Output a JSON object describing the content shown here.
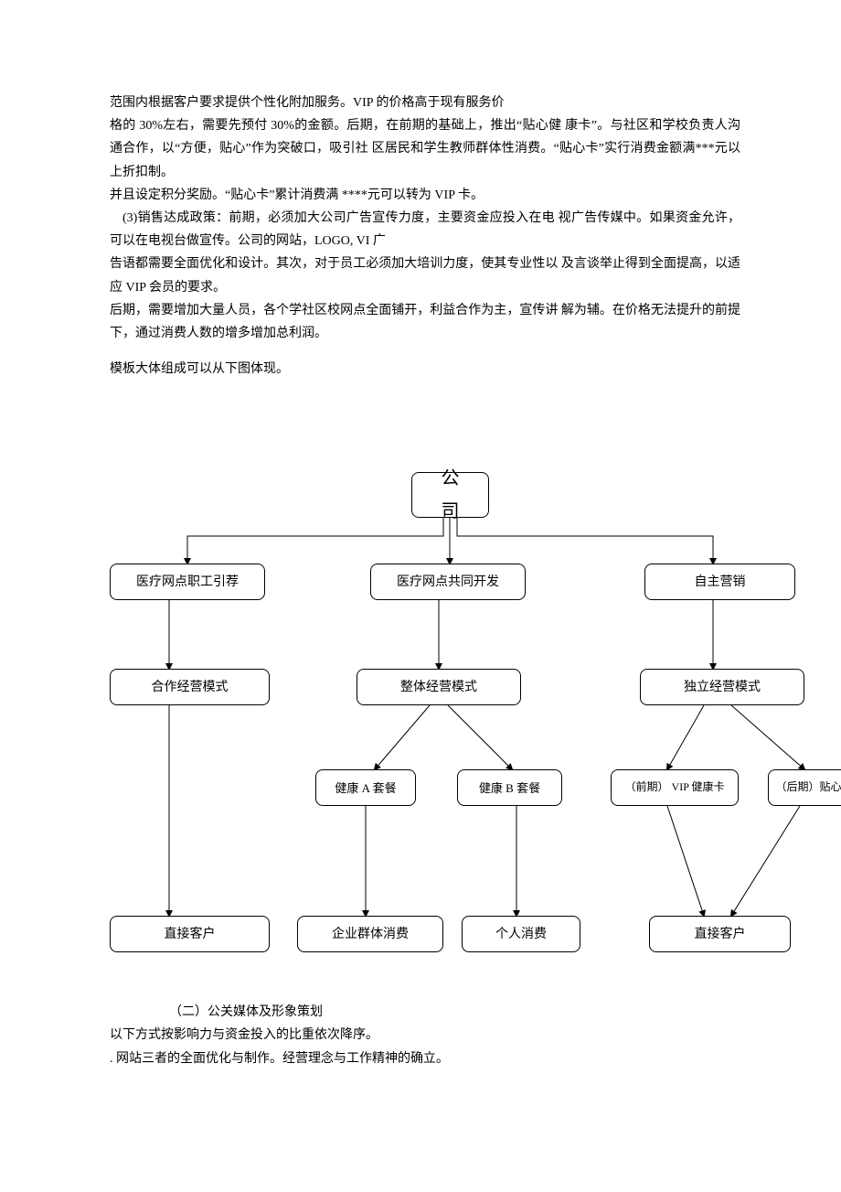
{
  "paragraphs": {
    "p1": "范围内根据客户要求提供个性化附加服务。VIP 的价格高于现有服务价",
    "p2": "格的 30%左右，需要先预付 30%的金额。后期，在前期的基础上，推出“贴心健 康卡”。与社区和学校负责人沟通合作，以“方便，贴心”作为突破口，吸引社 区居民和学生教师群体性消费。“贴心卡”实行消费金额满***元以上折扣制。",
    "p3": "并且设定积分奖励。“贴心卡”累计消费满 ****元可以转为 VIP 卡。",
    "p4": " (3)销售达成政策：前期，必须加大公司广告宣传力度，主要资金应投入在电 视广告传媒中。如果资金允许，可以在电视台做宣传。公司的网站，LOGO, VI 广",
    "p5": "告语都需要全面优化和设计。其次，对于员工必须加大培训力度，使其专业性以 及言谈举止得到全面提高，以适应 VIP 会员的要求。",
    "p6": "后期，需要增加大量人员，各个学社区校网点全面铺开，利益合作为主，宣传讲 解为辅。在价格无法提升的前提下，通过消费人数的增多增加总利润。",
    "p7": "模板大体组成可以从下图体现。"
  },
  "chart_data": {
    "type": "tree",
    "root": "公司",
    "children": [
      {
        "name": "医疗网点职工引荐",
        "model": "合作经营模式",
        "leaves": [
          "直接客户"
        ]
      },
      {
        "name": "医疗网点共同开发",
        "model": "整体经营模式",
        "products": [
          "健康 A 套餐",
          "健康 B 套餐"
        ],
        "leaves": [
          "企业群体消费",
          "个人消费"
        ]
      },
      {
        "name": "自主营销",
        "model": "独立经营模式",
        "products": [
          "（前期） VIP 健康卡",
          "（后期）贴心卡"
        ],
        "leaves": [
          "直接客户"
        ]
      }
    ]
  },
  "nodes": {
    "root": "公司",
    "l2a": "医疗网点职工引荐",
    "l2b": "医疗网点共同开发",
    "l2c": "自主营销",
    "l3a": "合作经营模式",
    "l3b": "整体经营模式",
    "l3c": "独立经营模式",
    "l4b1": "健康 A 套餐",
    "l4b2": "健康 B 套餐",
    "l4c1": "（前期） VIP 健康卡",
    "l4c2": "（后期）贴心卡",
    "l5a": "直接客户",
    "l5b1": "企业群体消费",
    "l5b2": "个人消费",
    "l5c": "直接客户"
  },
  "footer": {
    "f1": "（二）公关媒体及形象策划",
    "f2": "以下方式按影响力与资金投入的比重依次降序。",
    "f3": ". 网站三者的全面优化与制作。经营理念与工作精神的确立。"
  }
}
